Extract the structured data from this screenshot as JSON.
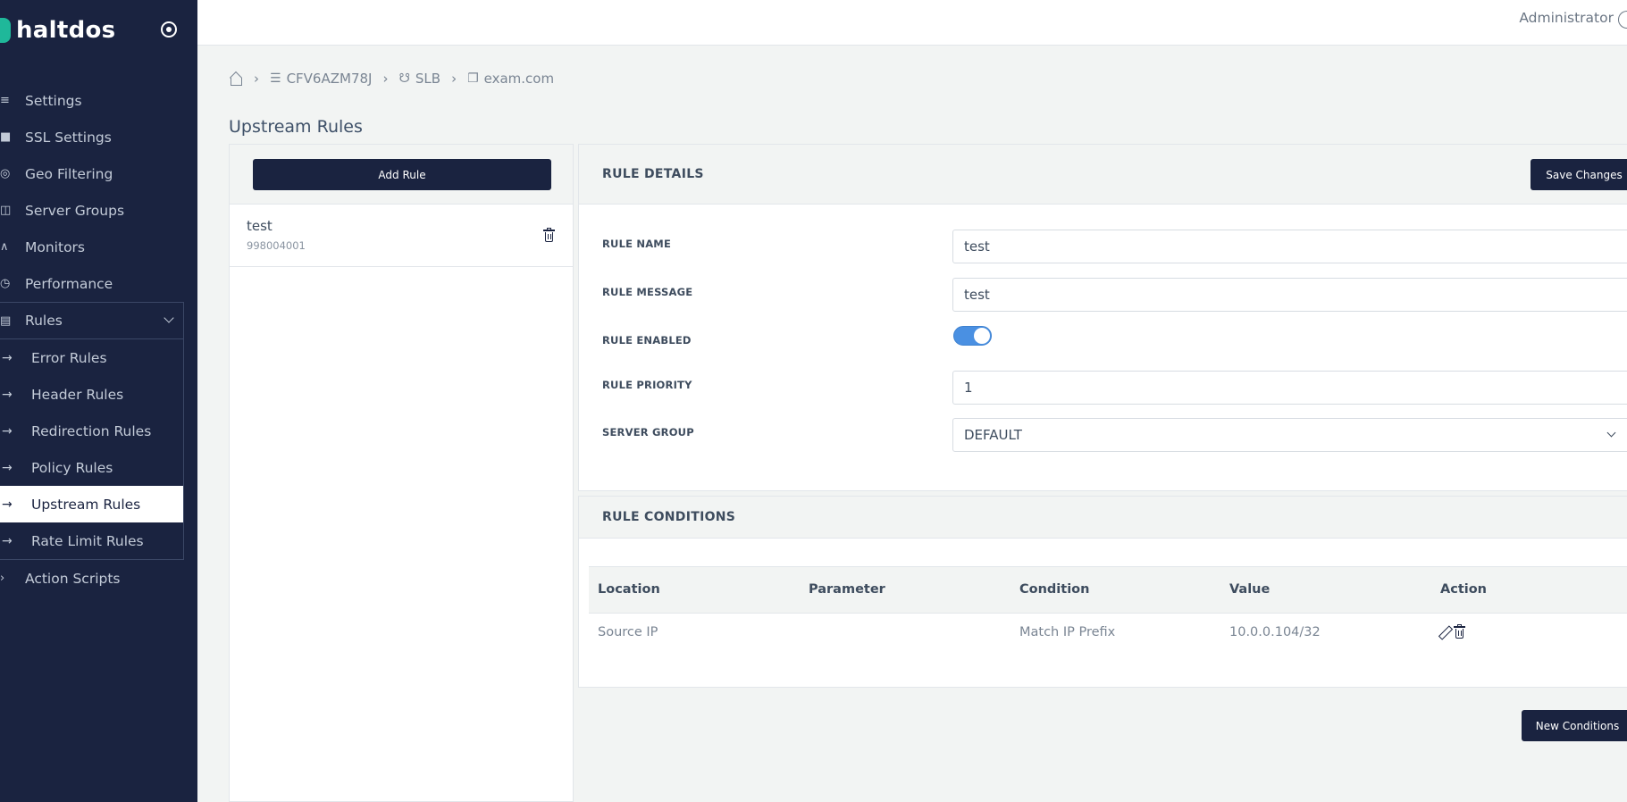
{
  "app": {
    "brand": "haltdos"
  },
  "topbar": {
    "user": "Administrator"
  },
  "sidebar": {
    "items": [
      {
        "label": "Settings",
        "icon": "sliders-icon"
      },
      {
        "label": "SSL Settings",
        "icon": "lock-icon"
      },
      {
        "label": "Geo Filtering",
        "icon": "globe-icon"
      },
      {
        "label": "Server Groups",
        "icon": "server-icon"
      },
      {
        "label": "Monitors",
        "icon": "pulse-icon"
      },
      {
        "label": "Performance",
        "icon": "stopwatch-icon"
      }
    ],
    "rules": {
      "label": "Rules",
      "sub_items": [
        {
          "label": "Error Rules"
        },
        {
          "label": "Header Rules"
        },
        {
          "label": "Redirection Rules"
        },
        {
          "label": "Policy Rules"
        },
        {
          "label": "Upstream Rules",
          "active": true
        },
        {
          "label": "Rate Limit Rules"
        }
      ]
    },
    "after": {
      "label": "Action Scripts"
    }
  },
  "breadcrumb": {
    "items": [
      "CFV6AZM78J",
      "SLB",
      "exam.com"
    ]
  },
  "page": {
    "title": "Upstream Rules"
  },
  "rules_list": {
    "add_label": "Add Rule",
    "items": [
      {
        "name": "test",
        "id": "998004001"
      }
    ]
  },
  "details": {
    "title": "RULE DETAILS",
    "save_label": "Save Changes",
    "fields": {
      "name": {
        "label": "RULE NAME",
        "value": "test"
      },
      "message": {
        "label": "RULE MESSAGE",
        "value": "test"
      },
      "enabled": {
        "label": "RULE ENABLED",
        "value": true
      },
      "priority": {
        "label": "RULE PRIORITY",
        "value": "1"
      },
      "server_group": {
        "label": "SERVER GROUP",
        "value": "DEFAULT"
      }
    }
  },
  "conditions": {
    "title": "RULE CONDITIONS",
    "columns": [
      "Location",
      "Parameter",
      "Condition",
      "Value",
      "Action"
    ],
    "rows": [
      {
        "location": "Source IP",
        "parameter": "",
        "condition": "Match IP Prefix",
        "value": "10.0.0.104/32"
      }
    ],
    "new_label": "New Conditions"
  },
  "colors": {
    "sidebar_bg": "#1a2340",
    "accent": "#1fb89a",
    "toggle_on": "#4a90e2"
  }
}
